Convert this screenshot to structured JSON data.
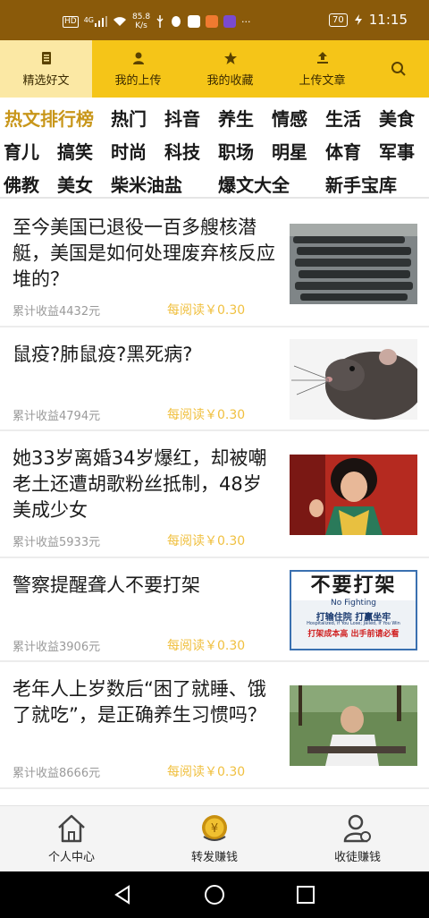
{
  "status_bar": {
    "hd": "HD",
    "signal": "4G",
    "speed_value": "85.8",
    "speed_unit": "K/s",
    "more": "···",
    "battery": "70",
    "time": "11:15"
  },
  "top_tabs": [
    {
      "label": "精选好文",
      "icon": "document-icon"
    },
    {
      "label": "我的上传",
      "icon": "person-icon"
    },
    {
      "label": "我的收藏",
      "icon": "star-icon"
    },
    {
      "label": "上传文章",
      "icon": "upload-icon"
    }
  ],
  "categories": {
    "row1": [
      "热文排行榜",
      "热门",
      "抖音",
      "养生",
      "情感",
      "生活",
      "美食"
    ],
    "row2": [
      "育儿",
      "搞笑",
      "时尚",
      "科技",
      "职场",
      "明星",
      "体育",
      "军事"
    ],
    "row3": [
      "佛教",
      "美女",
      "柴米油盐",
      "爆文大全",
      "新手宝库"
    ]
  },
  "articles": [
    {
      "title": "至今美国已退役一百多艘核潜艇，美国是如何处理废弃核反应堆的？",
      "earnings": "累计收益4432元",
      "rate": "每阅读￥0.30",
      "thumb": "submarines-image"
    },
    {
      "title": "鼠疫?肺鼠疫?黑死病?",
      "earnings": "累计收益4794元",
      "rate": "每阅读￥0.30",
      "thumb": "rat-image"
    },
    {
      "title": "她33岁离婚34岁爆红，却被嘲老土还遭胡歌粉丝抵制，48岁美成少女",
      "earnings": "累计收益5933元",
      "rate": "每阅读￥0.30",
      "thumb": "actress-image"
    },
    {
      "title": "警察提醒聋人不要打架",
      "earnings": "累计收益3906元",
      "rate": "每阅读￥0.30",
      "thumb": "no-fighting-sign-image",
      "sign": {
        "main": "不要打架",
        "en": "No Fighting",
        "sub": "打输住院 打赢坐牢",
        "sub_en": "Hospitalized, if You Lose; Jailed, If You Win",
        "red": "打架成本高 出手前请必看"
      }
    },
    {
      "title": "老年人上岁数后“困了就睡、饿了就吃”，是正确养生习惯吗？",
      "earnings": "累计收益8666元",
      "rate": "每阅读￥0.30",
      "thumb": "elderly-man-image"
    }
  ],
  "bottom_nav": [
    {
      "label": "个人中心",
      "icon": "home-icon"
    },
    {
      "label": "转发赚钱",
      "icon": "coin-icon",
      "coin_symbol": "¥"
    },
    {
      "label": "收徒赚钱",
      "icon": "add-person-icon"
    }
  ],
  "colors": {
    "status_bar": "#8a5a0a",
    "tab_bar": "#f5c518",
    "active_tab": "#fbe8a4",
    "hot_category": "#c8961a",
    "rate_text": "#f0c040"
  }
}
